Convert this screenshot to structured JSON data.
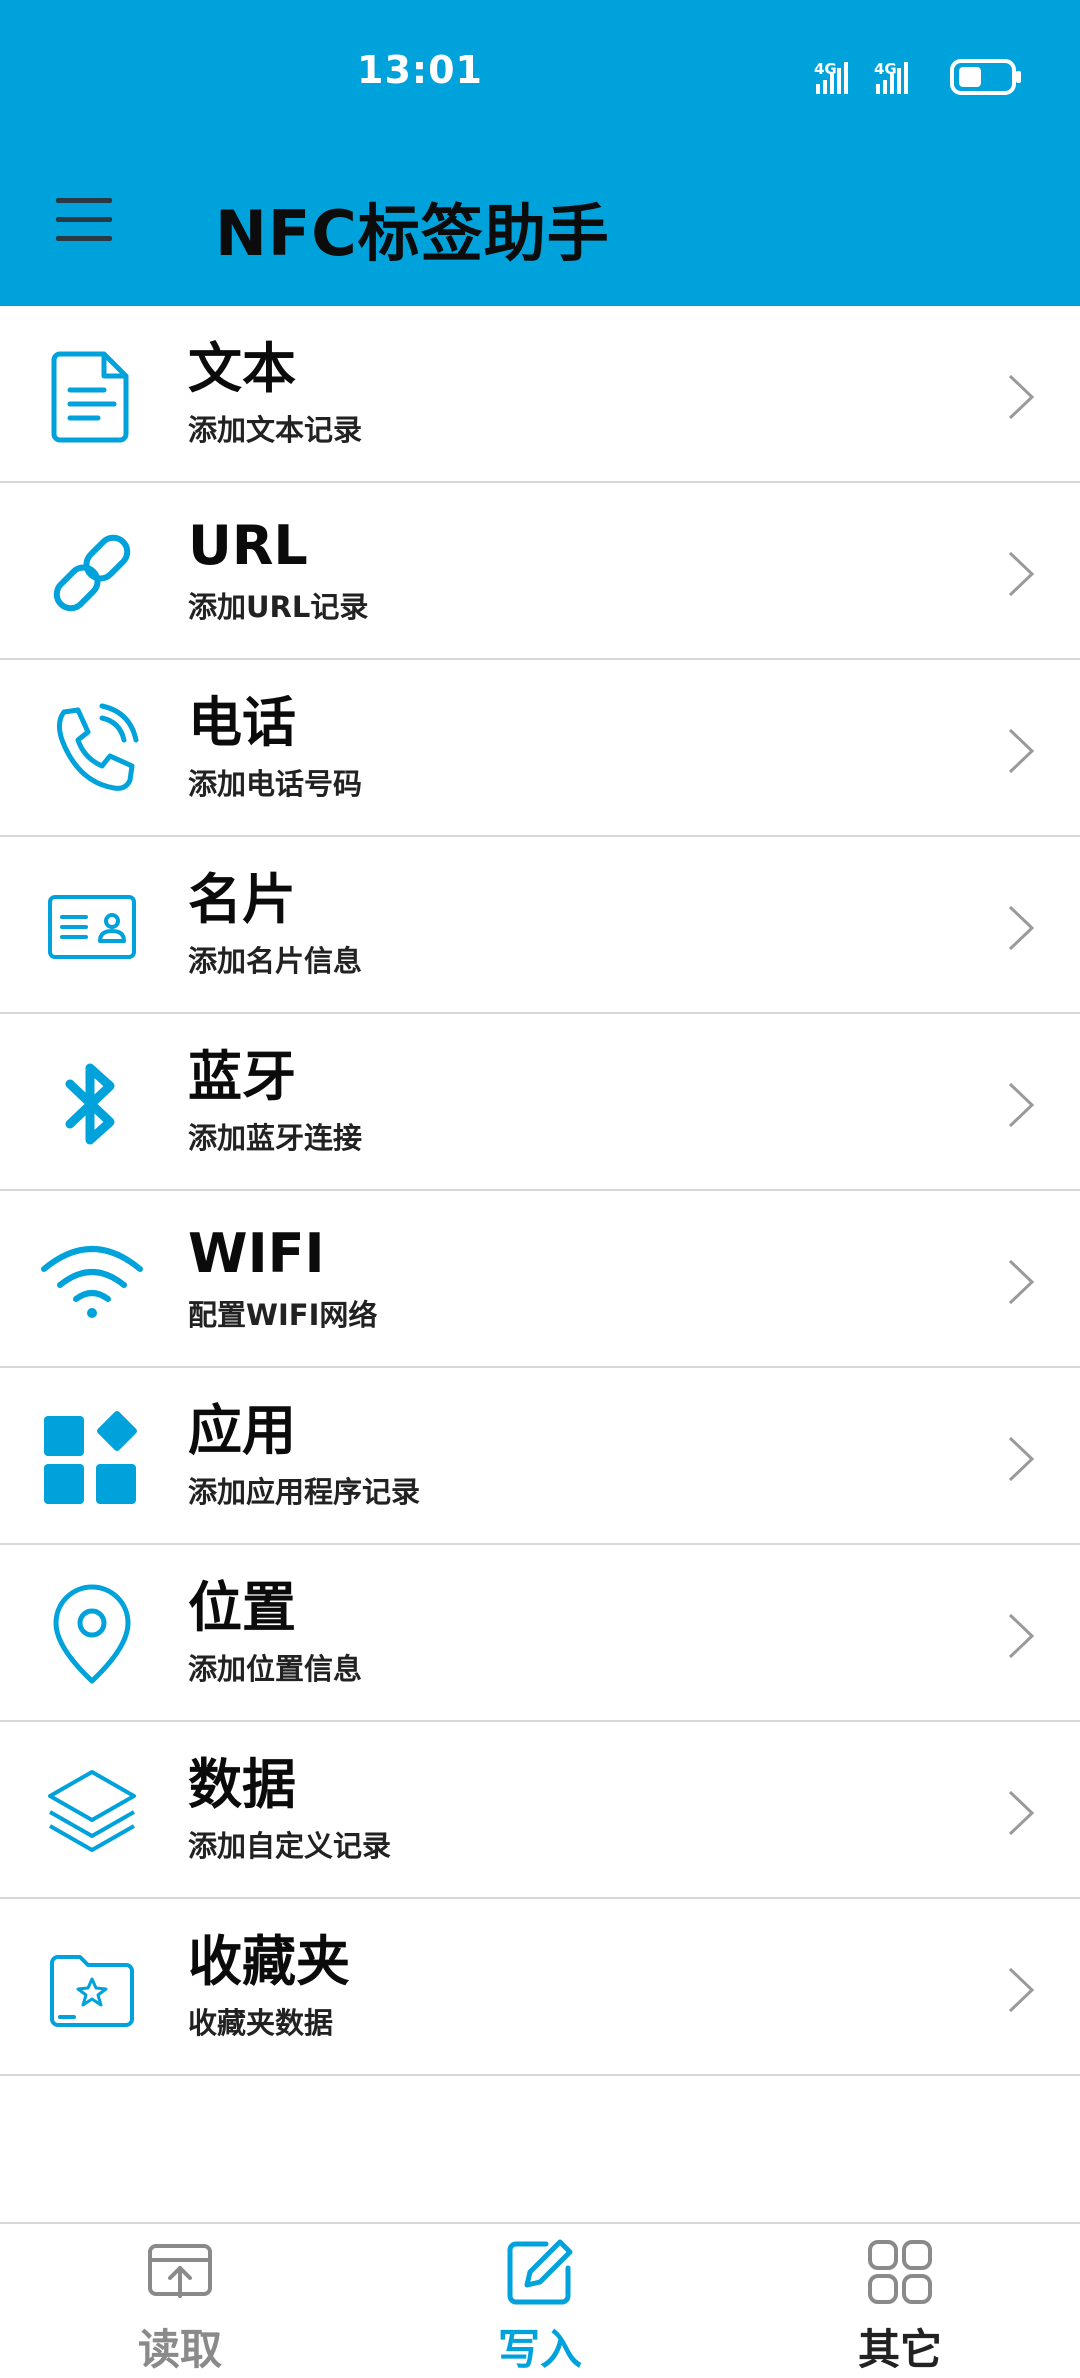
{
  "status_bar": {
    "time": "13:01",
    "signal_1_label": "4G",
    "signal_2_label": "4G"
  },
  "header": {
    "title": "NFC标签助手",
    "menu_icon": "hamburger-menu-icon"
  },
  "colors": {
    "accent": "#00A2DB",
    "nav_inactive": "#8a8a8a",
    "nav_active": "#00A2DB",
    "nav_other": "#222222"
  },
  "records": [
    {
      "icon": "document-icon",
      "title": "文本",
      "subtitle": "添加文本记录"
    },
    {
      "icon": "link-icon",
      "title": "URL",
      "subtitle": "添加URL记录"
    },
    {
      "icon": "phone-icon",
      "title": "电话",
      "subtitle": "添加电话号码"
    },
    {
      "icon": "business-card-icon",
      "title": "名片",
      "subtitle": "添加名片信息"
    },
    {
      "icon": "bluetooth-icon",
      "title": "蓝牙",
      "subtitle": "添加蓝牙连接"
    },
    {
      "icon": "wifi-icon",
      "title": "WIFI",
      "subtitle": "配置WIFI网络"
    },
    {
      "icon": "apps-icon",
      "title": "应用",
      "subtitle": "添加应用程序记录"
    },
    {
      "icon": "location-pin-icon",
      "title": "位置",
      "subtitle": "添加位置信息"
    },
    {
      "icon": "layers-icon",
      "title": "数据",
      "subtitle": "添加自定义记录"
    },
    {
      "icon": "favorites-folder-icon",
      "title": "收藏夹",
      "subtitle": "收藏夹数据"
    }
  ],
  "bottom_nav": [
    {
      "icon": "read-tray-icon",
      "label": "读取",
      "state": "inactive"
    },
    {
      "icon": "write-edit-icon",
      "label": "写入",
      "state": "active"
    },
    {
      "icon": "grid-other-icon",
      "label": "其它",
      "state": "inactive"
    }
  ]
}
